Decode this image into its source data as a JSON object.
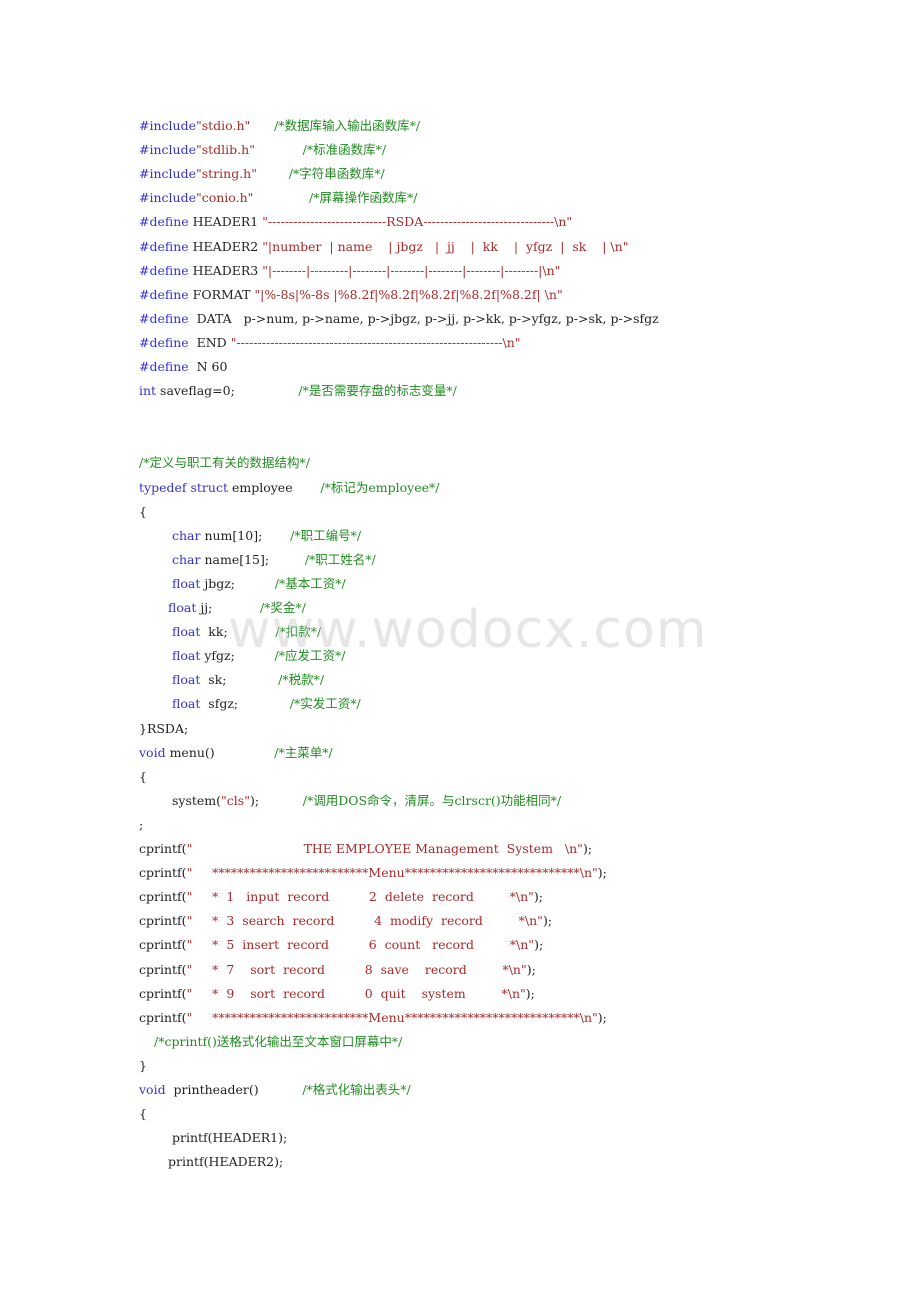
{
  "document": {
    "watermark": "www.wodocx.com",
    "lines": [
      {
        "indent": 0,
        "parts": [
          {
            "t": "kw",
            "v": "#include"
          },
          {
            "t": "str",
            "v": "\"stdio.h\""
          },
          {
            "t": "pl",
            "v": "      "
          },
          {
            "t": "cm",
            "v": "/*数据库输入输出函数库*/"
          }
        ]
      },
      {
        "indent": 0,
        "parts": [
          {
            "t": "kw",
            "v": "#include"
          },
          {
            "t": "str",
            "v": "\"stdlib.h\""
          },
          {
            "t": "pl",
            "v": "            "
          },
          {
            "t": "cm",
            "v": "/*标准函数库*/"
          }
        ]
      },
      {
        "indent": 0,
        "parts": [
          {
            "t": "kw",
            "v": "#include"
          },
          {
            "t": "str",
            "v": "\"string.h\""
          },
          {
            "t": "pl",
            "v": "        "
          },
          {
            "t": "cm",
            "v": "/*字符串函数库*/"
          }
        ]
      },
      {
        "indent": 0,
        "parts": [
          {
            "t": "kw",
            "v": "#include"
          },
          {
            "t": "str",
            "v": "\"conio.h\""
          },
          {
            "t": "pl",
            "v": "              "
          },
          {
            "t": "cm",
            "v": "/*屏幕操作函数库*/"
          }
        ]
      },
      {
        "indent": 0,
        "parts": [
          {
            "t": "kw",
            "v": "#define"
          },
          {
            "t": "pl",
            "v": " HEADER1 "
          },
          {
            "t": "str",
            "v": "\"----------------------------RSDA-------------------------------\\n\""
          }
        ]
      },
      {
        "indent": 0,
        "parts": [
          {
            "t": "kw",
            "v": "#define"
          },
          {
            "t": "pl",
            "v": " HEADER2 "
          },
          {
            "t": "str",
            "v": "\"|number  | name    | jbgz   |  jj    |  kk    |  yfgz  |  sk    | \\n\""
          }
        ]
      },
      {
        "indent": 0,
        "parts": [
          {
            "t": "kw",
            "v": "#define"
          },
          {
            "t": "pl",
            "v": " HEADER3 "
          },
          {
            "t": "str",
            "v": "\"|--------|---------|--------|--------|--------|--------|--------|\\n\""
          }
        ]
      },
      {
        "indent": 0,
        "parts": [
          {
            "t": "kw",
            "v": "#define"
          },
          {
            "t": "pl",
            "v": " FORMAT "
          },
          {
            "t": "str",
            "v": "\"|%-8s|%-8s |%8.2f|%8.2f|%8.2f|%8.2f|%8.2f| \\n\""
          }
        ]
      },
      {
        "indent": 0,
        "parts": [
          {
            "t": "kw",
            "v": "#define"
          },
          {
            "t": "pl",
            "v": "  DATA   p->num, p->name, p->jbgz, p->jj, p->kk, p->yfgz, p->sk, p->sfgz"
          }
        ]
      },
      {
        "indent": 0,
        "parts": [
          {
            "t": "kw",
            "v": "#define"
          },
          {
            "t": "pl",
            "v": "  END "
          },
          {
            "t": "str",
            "v": "\"---------------------------------------------------------------\\n\""
          }
        ]
      },
      {
        "indent": 0,
        "parts": [
          {
            "t": "kw",
            "v": "#define"
          },
          {
            "t": "pl",
            "v": "  N 60"
          }
        ]
      },
      {
        "indent": 0,
        "parts": [
          {
            "t": "kw",
            "v": "int"
          },
          {
            "t": "pl",
            "v": " saveflag=0;                "
          },
          {
            "t": "cm",
            "v": "/*是否需要存盘的标志变量*/"
          }
        ]
      },
      {
        "indent": 0,
        "parts": []
      },
      {
        "indent": 0,
        "parts": []
      },
      {
        "indent": 0,
        "parts": [
          {
            "t": "cm",
            "v": "/*定义与职工有关的数据结构*/"
          }
        ]
      },
      {
        "indent": 0,
        "parts": [
          {
            "t": "kw",
            "v": "typedef struct"
          },
          {
            "t": "pl",
            "v": " employee       "
          },
          {
            "t": "cm",
            "v": "/*标记为employee*/"
          }
        ]
      },
      {
        "indent": 0,
        "parts": [
          {
            "t": "pl",
            "v": "{"
          }
        ]
      },
      {
        "indent": 1,
        "parts": [
          {
            "t": "kw",
            "v": "char"
          },
          {
            "t": "pl",
            "v": " num[10];       "
          },
          {
            "t": "cm",
            "v": "/*职工编号*/"
          }
        ]
      },
      {
        "indent": 1,
        "parts": [
          {
            "t": "kw",
            "v": "char"
          },
          {
            "t": "pl",
            "v": " name[15];         "
          },
          {
            "t": "cm",
            "v": "/*职工姓名*/"
          }
        ]
      },
      {
        "indent": 1,
        "parts": [
          {
            "t": "kw",
            "v": "float"
          },
          {
            "t": "pl",
            "v": " jbgz;          "
          },
          {
            "t": "cm",
            "v": "/*基本工资*/"
          }
        ]
      },
      {
        "indent": 2,
        "parts": [
          {
            "t": "kw",
            "v": "float"
          },
          {
            "t": "pl",
            "v": " jj;            "
          },
          {
            "t": "cm",
            "v": "/*奖金*/"
          }
        ]
      },
      {
        "indent": 1,
        "parts": [
          {
            "t": "kw",
            "v": "float"
          },
          {
            "t": "pl",
            "v": "  kk;            "
          },
          {
            "t": "cm",
            "v": "/*扣款*/"
          }
        ]
      },
      {
        "indent": 1,
        "parts": [
          {
            "t": "kw",
            "v": "float"
          },
          {
            "t": "pl",
            "v": " yfgz;          "
          },
          {
            "t": "cm",
            "v": "/*应发工资*/"
          }
        ]
      },
      {
        "indent": 1,
        "parts": [
          {
            "t": "kw",
            "v": "float"
          },
          {
            "t": "pl",
            "v": "  sk;             "
          },
          {
            "t": "cm",
            "v": "/*税款*/"
          }
        ]
      },
      {
        "indent": 1,
        "parts": [
          {
            "t": "kw",
            "v": "float"
          },
          {
            "t": "pl",
            "v": "  sfgz;             "
          },
          {
            "t": "cm",
            "v": "/*实发工资*/"
          }
        ]
      },
      {
        "indent": 0,
        "parts": [
          {
            "t": "pl",
            "v": "}RSDA;"
          }
        ]
      },
      {
        "indent": 0,
        "parts": [
          {
            "t": "kw",
            "v": "void"
          },
          {
            "t": "pl",
            "v": " menu()               "
          },
          {
            "t": "cm",
            "v": "/*主菜单*/"
          }
        ]
      },
      {
        "indent": 0,
        "parts": [
          {
            "t": "pl",
            "v": "{"
          }
        ]
      },
      {
        "indent": 1,
        "parts": [
          {
            "t": "pl",
            "v": "system("
          },
          {
            "t": "str",
            "v": "\"cls\""
          },
          {
            "t": "pl",
            "v": ");           "
          },
          {
            "t": "cm",
            "v": "/*调用DOS命令，清屏。与clrscr()功能相同*/"
          }
        ]
      },
      {
        "indent": 0,
        "parts": [
          {
            "t": "pl",
            "v": ";"
          }
        ]
      },
      {
        "indent": 0,
        "parts": [
          {
            "t": "pl",
            "v": "cprintf("
          },
          {
            "t": "str",
            "v": "\"                            THE EMPLOYEE Management  System   \\n\""
          },
          {
            "t": "pl",
            "v": ");"
          }
        ]
      },
      {
        "indent": 0,
        "parts": [
          {
            "t": "pl",
            "v": "cprintf("
          },
          {
            "t": "str",
            "v": "\"     *************************Menu****************************\\n\""
          },
          {
            "t": "pl",
            "v": ");"
          }
        ]
      },
      {
        "indent": 0,
        "parts": [
          {
            "t": "pl",
            "v": "cprintf("
          },
          {
            "t": "str",
            "v": "\"     *  1   input  record          2  delete  record         *\\n\""
          },
          {
            "t": "pl",
            "v": ");"
          }
        ]
      },
      {
        "indent": 0,
        "parts": [
          {
            "t": "pl",
            "v": "cprintf("
          },
          {
            "t": "str",
            "v": "\"     *  3  search  record          4  modify  record         *\\n\""
          },
          {
            "t": "pl",
            "v": ");"
          }
        ]
      },
      {
        "indent": 0,
        "parts": [
          {
            "t": "pl",
            "v": "cprintf("
          },
          {
            "t": "str",
            "v": "\"     *  5  insert  record          6  count   record         *\\n\""
          },
          {
            "t": "pl",
            "v": ");"
          }
        ]
      },
      {
        "indent": 0,
        "parts": [
          {
            "t": "pl",
            "v": "cprintf("
          },
          {
            "t": "str",
            "v": "\"     *  7    sort  record          8  save    record         *\\n\""
          },
          {
            "t": "pl",
            "v": ");"
          }
        ]
      },
      {
        "indent": 0,
        "parts": [
          {
            "t": "pl",
            "v": "cprintf("
          },
          {
            "t": "str",
            "v": "\"     *  9    sort  record          0  quit    system         *\\n\""
          },
          {
            "t": "pl",
            "v": ");"
          }
        ]
      },
      {
        "indent": 0,
        "parts": [
          {
            "t": "pl",
            "v": "cprintf("
          },
          {
            "t": "str",
            "v": "\"     *************************Menu****************************\\n\""
          },
          {
            "t": "pl",
            "v": ");"
          }
        ]
      },
      {
        "indent": 3,
        "parts": [
          {
            "t": "cm",
            "v": "/*cprintf()送格式化输出至文本窗口屏幕中*/"
          }
        ]
      },
      {
        "indent": 0,
        "parts": [
          {
            "t": "pl",
            "v": "}"
          }
        ]
      },
      {
        "indent": 0,
        "parts": [
          {
            "t": "kw",
            "v": "void"
          },
          {
            "t": "pl",
            "v": "  printheader()           "
          },
          {
            "t": "cm",
            "v": "/*格式化输出表头*/"
          }
        ]
      },
      {
        "indent": 0,
        "parts": [
          {
            "t": "pl",
            "v": "{"
          }
        ]
      },
      {
        "indent": 1,
        "parts": [
          {
            "t": "pl",
            "v": "printf(HEADER1);"
          }
        ]
      },
      {
        "indent": 2,
        "parts": [
          {
            "t": "pl",
            "v": "printf(HEADER2);"
          }
        ]
      }
    ]
  }
}
